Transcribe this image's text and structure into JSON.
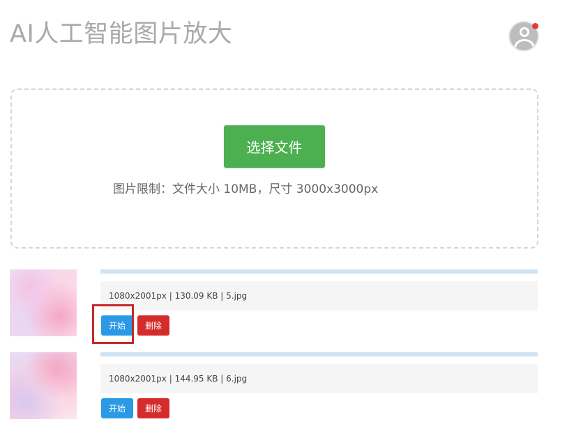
{
  "app": {
    "title": "AI人工智能图片放大"
  },
  "header": {
    "avatar_icon": "user-avatar-icon",
    "notification_color": "#e53935"
  },
  "upload": {
    "choose_button_label": "选择文件",
    "limit_text": "图片限制：文件大小 10MB，尺寸 3000x3000px",
    "button_color": "#4cb050"
  },
  "files": [
    {
      "info": "1080x2001px | 130.09 KB | 5.jpg",
      "start_label": "开始",
      "delete_label": "删除"
    },
    {
      "info": "1080x2001px | 144.95 KB | 6.jpg",
      "start_label": "开始",
      "delete_label": "删除"
    }
  ],
  "colors": {
    "start_button": "#2a9ae6",
    "delete_button": "#d52b2b",
    "progress_track": "#cfe3f3",
    "highlight": "#c62828"
  }
}
